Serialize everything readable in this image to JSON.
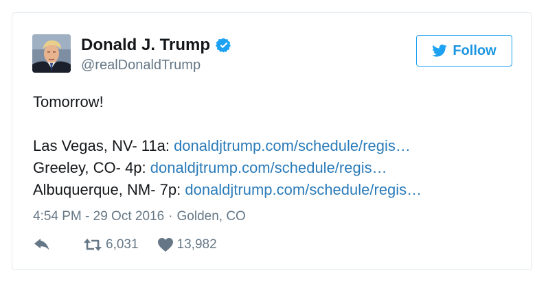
{
  "user": {
    "name": "Donald J. Trump",
    "handle": "@realDonaldTrump",
    "verified": true
  },
  "follow_label": "Follow",
  "tweet": {
    "intro": "Tomorrow!",
    "stops": [
      {
        "prefix": "Las Vegas, NV- 11a: ",
        "link": "donaldjtrump.com/schedule/regis…"
      },
      {
        "prefix": "Greeley, CO- 4p: ",
        "link": "donaldjtrump.com/schedule/regis…"
      },
      {
        "prefix": "Albuquerque, NM- 7p: ",
        "link": "donaldjtrump.com/schedule/regis…"
      }
    ]
  },
  "meta": {
    "timestamp": "4:54 PM - 29 Oct 2016",
    "separator": "·",
    "location": "Golden, CO"
  },
  "stats": {
    "retweets": "6,031",
    "likes": "13,982"
  },
  "icons": {
    "verified": "verified-badge-icon",
    "follow": "twitter-bird-icon",
    "reply": "reply-icon",
    "retweet": "retweet-icon",
    "like": "heart-icon"
  },
  "colors": {
    "link": "#2b7bb9",
    "accent": "#1da1f2",
    "muted": "#657786",
    "text": "#14171a"
  }
}
